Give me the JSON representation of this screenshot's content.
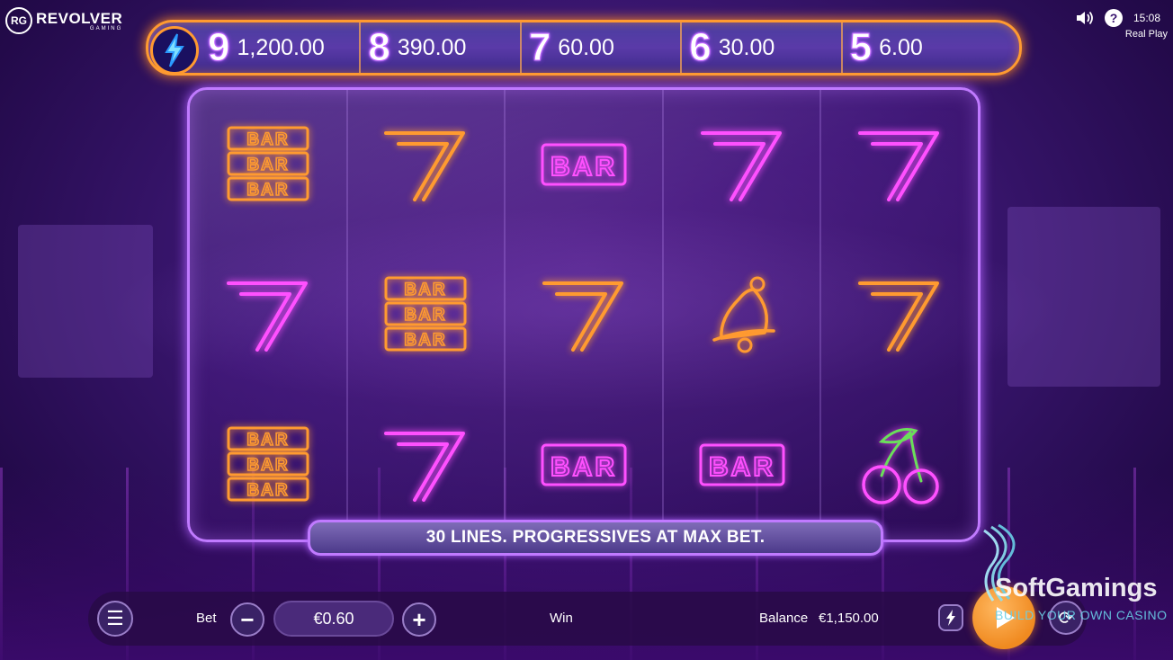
{
  "logo": {
    "badge": "RG",
    "name": "REVOLVER",
    "sub": "GAMING"
  },
  "topbar": {
    "time": "15:08",
    "mode": "Real Play"
  },
  "jackpots": [
    {
      "symbol": "9",
      "amount": "1,200.00"
    },
    {
      "symbol": "8",
      "amount": "390.00"
    },
    {
      "symbol": "7",
      "amount": "60.00"
    },
    {
      "symbol": "6",
      "amount": "30.00"
    },
    {
      "symbol": "5",
      "amount": "6.00"
    }
  ],
  "reels": [
    [
      "bar3-orange",
      "seven-pink",
      "bar3-orange"
    ],
    [
      "seven-orange",
      "bar3-orange",
      "seven-pink"
    ],
    [
      "bar1-pink",
      "seven-orange",
      "bar1-pink"
    ],
    [
      "seven-pink",
      "bell-orange",
      "bar1-pink"
    ],
    [
      "seven-pink",
      "seven-orange",
      "cherry"
    ]
  ],
  "symbol_text": {
    "bar": "BAR"
  },
  "message": "30 LINES. PROGRESSIVES AT MAX BET.",
  "controls": {
    "bet_label": "Bet",
    "bet_value": "€0.60",
    "win_label": "Win",
    "balance_label": "Balance",
    "balance_value": "€1,150.00"
  },
  "watermark": {
    "name": "SoftGamings",
    "tagline": "BUILD YOUR OWN CASINO"
  },
  "colors": {
    "accent_orange": "#ff9a30",
    "neon_pink": "#ff40ff",
    "neon_purple": "#c07aff",
    "spin_orange": "#f08a20"
  }
}
